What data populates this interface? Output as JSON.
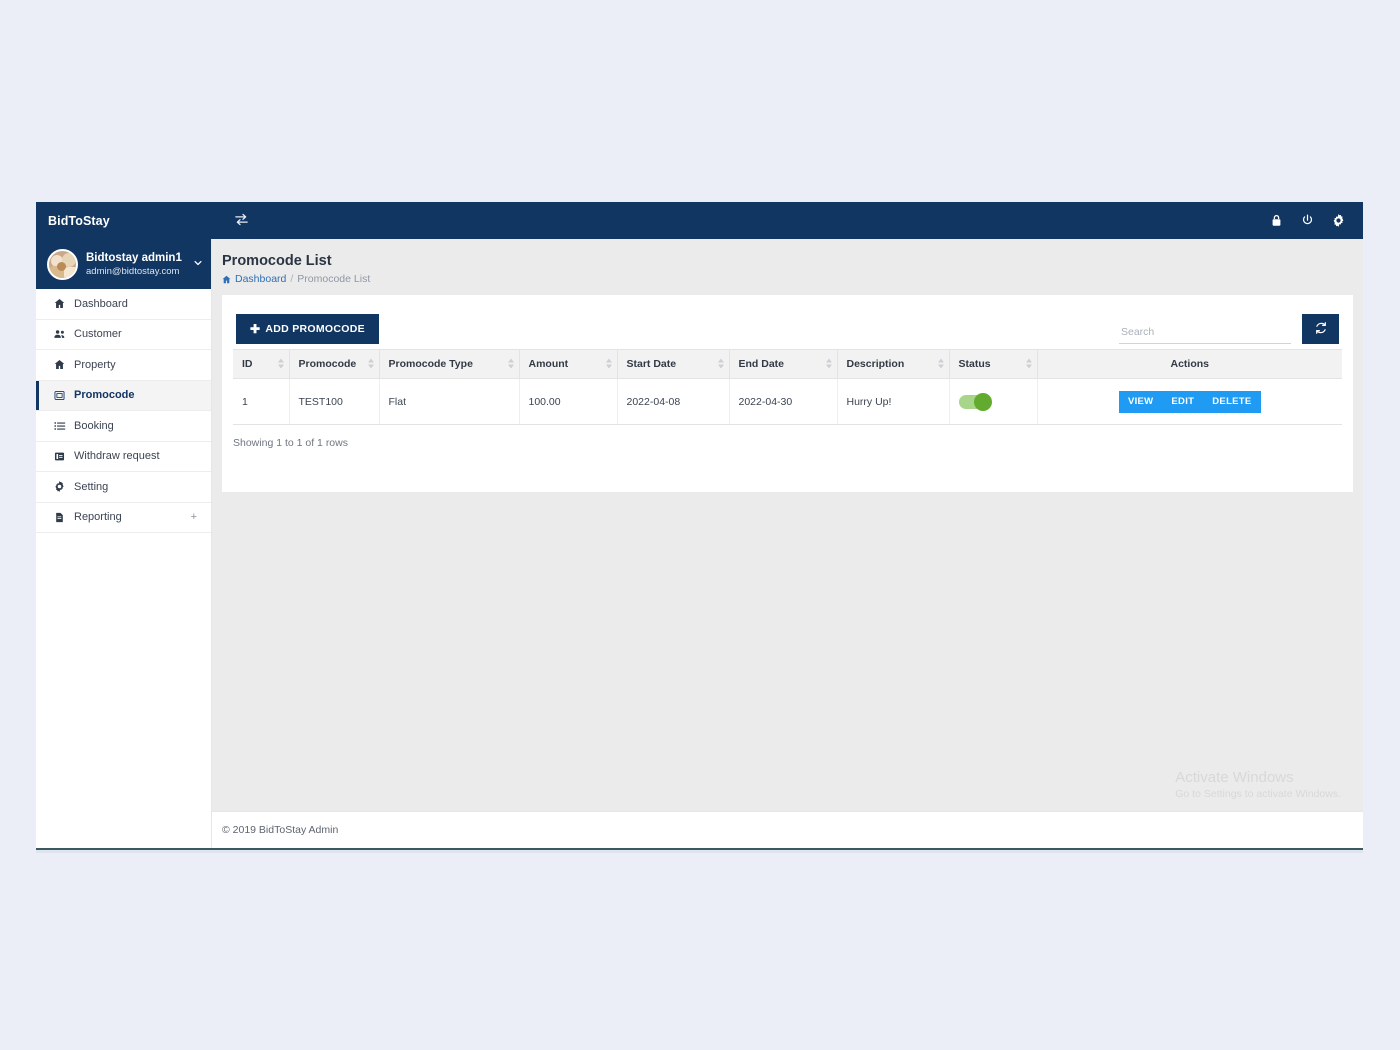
{
  "topbar": {
    "brand": "BidToStay",
    "sidebar_toggle_icon": "exchange-arrows-icon",
    "icons": [
      {
        "name": "lock-icon",
        "label": "Lock"
      },
      {
        "name": "power-icon",
        "label": "Power"
      },
      {
        "name": "gear-icon",
        "label": "Settings"
      }
    ]
  },
  "user": {
    "name": "Bidtostay admin1",
    "email": "admin@bidtostay.com",
    "caret_icon": "chevron-down-icon"
  },
  "sidebar": {
    "items": [
      {
        "label": "Dashboard",
        "icon": "home-icon",
        "active": false,
        "expandable": false
      },
      {
        "label": "Customer",
        "icon": "users-icon",
        "active": false,
        "expandable": false
      },
      {
        "label": "Property",
        "icon": "home-icon",
        "active": false,
        "expandable": false
      },
      {
        "label": "Promocode",
        "icon": "ticket-icon",
        "active": true,
        "expandable": false
      },
      {
        "label": "Booking",
        "icon": "list-icon",
        "active": false,
        "expandable": false
      },
      {
        "label": "Withdraw request",
        "icon": "wallet-icon",
        "active": false,
        "expandable": false
      },
      {
        "label": "Setting",
        "icon": "gear-icon",
        "active": false,
        "expandable": false
      },
      {
        "label": "Reporting",
        "icon": "file-icon",
        "active": false,
        "expandable": true,
        "expand_symbol": "+"
      }
    ]
  },
  "page": {
    "title": "Promocode List",
    "breadcrumb": {
      "home_icon": "home-icon",
      "root": "Dashboard",
      "separator": "/",
      "current": "Promocode List"
    }
  },
  "toolbar": {
    "add_label": "ADD PROMOCODE",
    "add_icon": "plus-icon",
    "search_placeholder": "Search",
    "search_value": "",
    "refresh_icon": "refresh-icon"
  },
  "table": {
    "columns": [
      {
        "label": "ID",
        "sortable": true
      },
      {
        "label": "Promocode",
        "sortable": true
      },
      {
        "label": "Promocode Type",
        "sortable": true
      },
      {
        "label": "Amount",
        "sortable": true
      },
      {
        "label": "Start Date",
        "sortable": true
      },
      {
        "label": "End Date",
        "sortable": true
      },
      {
        "label": "Description",
        "sortable": true
      },
      {
        "label": "Status",
        "sortable": true
      },
      {
        "label": "Actions",
        "sortable": false
      }
    ],
    "rows": [
      {
        "id": "1",
        "promocode": "TEST100",
        "promocode_type": "Flat",
        "amount": "100.00",
        "start_date": "2022-04-08",
        "end_date": "2022-04-30",
        "description": "Hurry Up!",
        "status_on": true,
        "actions": [
          "VIEW",
          "EDIT",
          "DELETE"
        ]
      }
    ],
    "info": "Showing 1 to 1 of 1 rows"
  },
  "watermark": {
    "title": "Activate Windows",
    "subtitle": "Go to Settings to activate Windows."
  },
  "footer": {
    "copyright": "© 2019 BidToStay Admin"
  },
  "colors": {
    "navy": "#123662",
    "accent_blue": "#1f9bf4",
    "link_blue": "#2f6fb5",
    "toggle_green": "#62ab2e",
    "page_bg": "#eceef7",
    "content_bg": "#ebebeb"
  }
}
